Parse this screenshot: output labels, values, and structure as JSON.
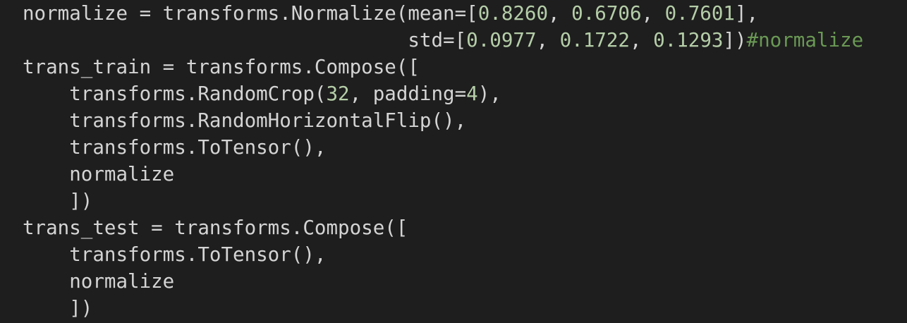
{
  "colors": {
    "background": "#1e1e1e",
    "text": "#d4d4d4",
    "number": "#b5cea8",
    "comment": "#6a9955"
  },
  "code_lines": [
    [
      {
        "text": "normalize = transforms.Normalize(mean=[",
        "style": "txt"
      },
      {
        "text": "0.8260",
        "style": "num"
      },
      {
        "text": ", ",
        "style": "txt"
      },
      {
        "text": "0.6706",
        "style": "num"
      },
      {
        "text": ", ",
        "style": "txt"
      },
      {
        "text": "0.7601",
        "style": "num"
      },
      {
        "text": "],",
        "style": "txt"
      }
    ],
    [
      {
        "text": "                                 std=[",
        "style": "txt"
      },
      {
        "text": "0.0977",
        "style": "num"
      },
      {
        "text": ", ",
        "style": "txt"
      },
      {
        "text": "0.1722",
        "style": "num"
      },
      {
        "text": ", ",
        "style": "txt"
      },
      {
        "text": "0.1293",
        "style": "num"
      },
      {
        "text": "])",
        "style": "txt"
      },
      {
        "text": "#normalize",
        "style": "com"
      }
    ],
    [
      {
        "text": "trans_train = transforms.Compose([",
        "style": "txt"
      }
    ],
    [
      {
        "text": "    transforms.RandomCrop(",
        "style": "txt"
      },
      {
        "text": "32",
        "style": "num"
      },
      {
        "text": ", padding=",
        "style": "txt"
      },
      {
        "text": "4",
        "style": "num"
      },
      {
        "text": "),",
        "style": "txt"
      }
    ],
    [
      {
        "text": "    transforms.RandomHorizontalFlip(),",
        "style": "txt"
      }
    ],
    [
      {
        "text": "    transforms.ToTensor(),",
        "style": "txt"
      }
    ],
    [
      {
        "text": "    normalize",
        "style": "txt"
      }
    ],
    [
      {
        "text": "    ])",
        "style": "txt"
      }
    ],
    [
      {
        "text": "trans_test = transforms.Compose([",
        "style": "txt"
      }
    ],
    [
      {
        "text": "    transforms.ToTensor(),",
        "style": "txt"
      }
    ],
    [
      {
        "text": "    normalize",
        "style": "txt"
      }
    ],
    [
      {
        "text": "    ])",
        "style": "txt"
      }
    ]
  ]
}
